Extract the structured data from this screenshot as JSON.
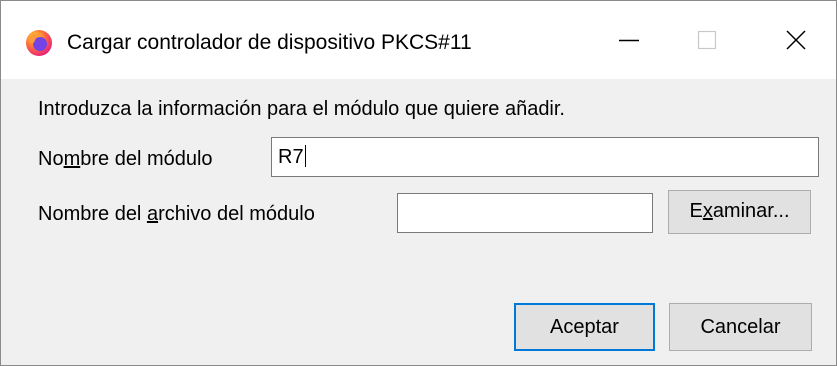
{
  "window": {
    "title": "Cargar controlador de dispositivo PKCS#11",
    "app_icon": "firefox-icon",
    "controls": {
      "minimize_icon": "minimize-icon",
      "maximize_icon": "maximize-icon",
      "close_icon": "close-icon"
    }
  },
  "form": {
    "intro": "Introduzca la información para el módulo que quiere añadir.",
    "module_name": {
      "label_pre": "No",
      "label_access": "m",
      "label_post": "bre del módulo",
      "value": "R7"
    },
    "module_file": {
      "label_pre": "Nombre del ",
      "label_access": "a",
      "label_post": "rchivo del módulo",
      "value": ""
    },
    "browse_button": {
      "label_pre": "E",
      "label_access": "x",
      "label_post": "aminar..."
    }
  },
  "buttons": {
    "ok": "Aceptar",
    "cancel": "Cancelar"
  },
  "colors": {
    "dialog_bg": "#f0f0f0",
    "titlebar_bg": "#ffffff",
    "default_button_border": "#0078d7",
    "button_bg": "#e1e1e1"
  }
}
